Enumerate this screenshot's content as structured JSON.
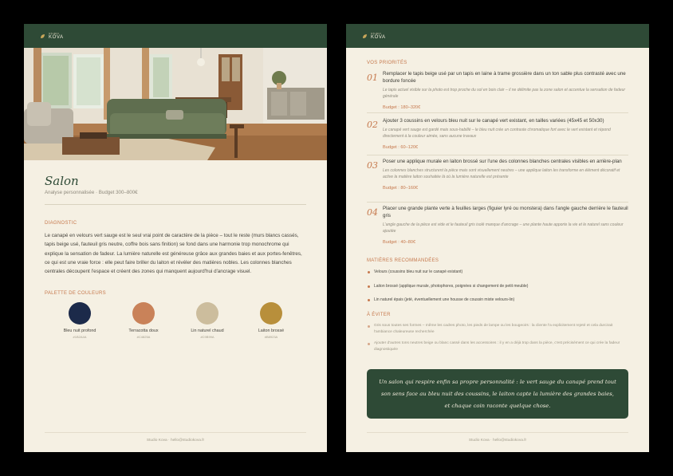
{
  "brand": {
    "sub": "STUDIO",
    "name": "KOVA"
  },
  "left": {
    "title": "Salon",
    "subtitle": "Analyse personnalisée · Budget 300–800€",
    "diagnostic_label": "Diagnostic",
    "diagnostic_text": "Le canapé en velours vert sauge est le seul vrai point de caractère de la pièce – tout le reste (murs blancs cassés, tapis beige usé, fauteuil gris neutre, coffre bois sans finition) se fond dans une harmonie trop monochrome qui explique la sensation de fadeur. La lumière naturelle est généreuse grâce aux grandes baies et aux portes-fenêtres, ce qui est une vraie force : elle peut faire briller du laiton et révéler des matières nobles. Les colonnes blanches centrales découpent l'espace et créent des zones qui manquent aujourd'hui d'ancrage visuel.",
    "palette_label": "Palette de couleurs",
    "palette": [
      {
        "name": "Bleu nuit profond",
        "hex": "#1B2A4A",
        "color": "#1c2a4a"
      },
      {
        "name": "Terracotta doux",
        "hex": "#C4825A",
        "color": "#c98259"
      },
      {
        "name": "Lin naturel chaud",
        "hex": "#C9B99A",
        "color": "#ccbd9d"
      },
      {
        "name": "Laiton brossé",
        "hex": "#B8923A",
        "color": "#b88f3b"
      }
    ],
    "footer": "Studio Kova · hello@studiokova.fr"
  },
  "right": {
    "priorities_label": "Vos priorités",
    "priorities": [
      {
        "num": "01",
        "main": "Remplacer le tapis beige usé par un tapis en laine à trame grossière dans un ton sable plus contrasté avec une bordure foncée",
        "why": "Le tapis actuel visible sur la photo est trop proche du sol en bois clair – il ne délimite pas la zone salon et accentue la sensation de fadeur générale",
        "budget": "Budget : 180–320€"
      },
      {
        "num": "02",
        "main": "Ajouter 3 coussins en velours bleu nuit sur le canapé vert existant, en tailles variées (45x45 et 50x30)",
        "why": "Le canapé vert sauge est gardé mais sous-habillé – le bleu nuit crée un contraste chromatique fort avec le vert existant et répond directement à la couleur aimée, sans aucune travaux",
        "budget": "Budget : 60–120€"
      },
      {
        "num": "03",
        "main": "Poser une applique murale en laiton brossé sur l'une des colonnes blanches centrales visibles en arrière-plan",
        "why": "Les colonnes blanches structurent la pièce mais sont visuellement neutres – une applique laiton les transforme en élément décoratif et active la matière laiton souhaitée là où la lumière naturelle est présente",
        "budget": "Budget : 80–160€"
      },
      {
        "num": "04",
        "main": "Placer une grande plante verte à feuilles larges (figuier lyré ou monstera) dans l'angle gauche derrière le fauteuil gris",
        "why": "L'angle gauche de la pièce est vide et le fauteuil gris isolé manque d'ancrage – une plante haute apporte la vie et le naturel sans couleur ajoutée",
        "budget": "Budget : 40–80€"
      }
    ],
    "materials_label": "Matières recommandées",
    "materials": [
      "Velours (coussins bleu nuit sur le canapé existant)",
      "Laiton brossé (applique murale, photophores, poignées si changement de petit meuble)",
      "Lin naturel épais (jeté, éventuellement une housse de coussin mixte velours-lin)"
    ],
    "avoid_label": "À éviter",
    "avoid": [
      "Gris sous toutes ses formes – même les cadres photo, les pieds de lampe ou les bougeoirs : la cliente l'a explicitement rejeté et cela durcirait l'ambiance chaleureuse recherchée",
      "Ajouter d'autres tons neutres beige ou blanc cassé dans les accessoires : il y en a déjà trop dans la pièce, c'est précisément ce qui crée la fadeur diagnostiquée"
    ],
    "quote": "Un salon qui respire enfin sa propre personnalité : le vert sauge du canapé prend tout son sens face au bleu nuit des coussins, le laiton capte la lumière des grandes baies, et chaque coin raconte quelque chose.",
    "footer": "Studio Kova · hello@studiokova.fr"
  }
}
